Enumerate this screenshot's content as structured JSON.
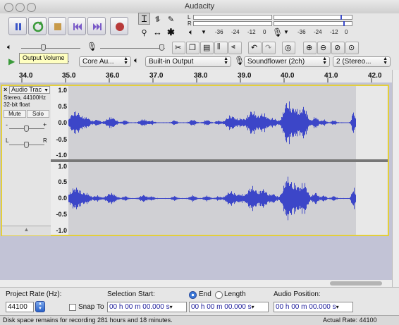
{
  "window": {
    "title": "Audacity"
  },
  "meters": {
    "play_scale": [
      "-36",
      "-24",
      "-12",
      "0"
    ],
    "rec_scale": [
      "-36",
      "-24",
      "-12",
      "0"
    ],
    "channel_L": "L",
    "channel_R": "R"
  },
  "tooltip": "Output Volume",
  "devices": {
    "host": "Core Au...",
    "output": "Built-in Output",
    "input": "Soundflower (2ch)",
    "channels": "2 (Stereo..."
  },
  "ruler": {
    "ticks": [
      "34.0",
      "35.0",
      "36.0",
      "37.0",
      "38.0",
      "39.0",
      "40.0",
      "41.0",
      "42.0"
    ]
  },
  "track": {
    "name": "Audio Trac",
    "info_line1": "Stereo, 44100Hz",
    "info_line2": "32-bit float",
    "mute_label": "Mute",
    "solo_label": "Solo",
    "gain_minus": "-",
    "gain_plus": "+",
    "pan_left": "L",
    "pan_right": "R",
    "scale": [
      "1.0",
      "0.5",
      "0.0",
      "-0.5",
      "-1.0"
    ]
  },
  "selection_bar": {
    "project_rate_label": "Project Rate (Hz):",
    "project_rate_value": "44100",
    "snap_to_label": "Snap To",
    "selection_start_label": "Selection Start:",
    "end_label": "End",
    "length_label": "Length",
    "audio_position_label": "Audio Position:",
    "selection_start_value": "00 h 00 m 00.000 s",
    "selection_end_value": "00 h 00 m 00.000 s",
    "audio_position_value": "00 h 00 m 00.000 s"
  },
  "status": {
    "left": "Disk space remains for recording 281 hours and 18 minutes.",
    "right": "Actual Rate: 44100"
  },
  "colors": {
    "waveform": "#3c46c8",
    "track_highlight": "#e3cf3a",
    "track_background": "#c2c3d6"
  }
}
